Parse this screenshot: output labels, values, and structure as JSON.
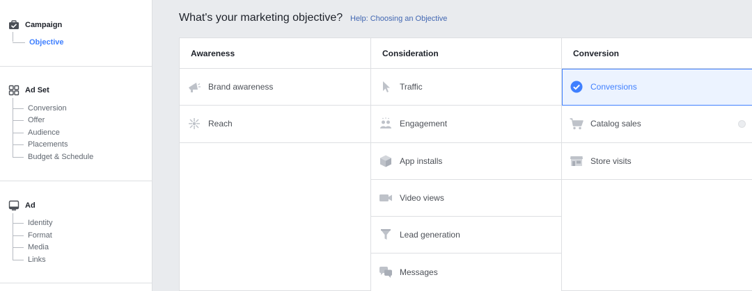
{
  "sidebar": {
    "campaign": {
      "label": "Campaign",
      "icon": "briefcase-icon",
      "items": [
        {
          "label": "Objective",
          "active": true
        }
      ]
    },
    "adset": {
      "label": "Ad Set",
      "icon": "grid-icon",
      "items": [
        {
          "label": "Conversion"
        },
        {
          "label": "Offer"
        },
        {
          "label": "Audience"
        },
        {
          "label": "Placements"
        },
        {
          "label": "Budget & Schedule"
        }
      ]
    },
    "ad": {
      "label": "Ad",
      "icon": "monitor-icon",
      "items": [
        {
          "label": "Identity"
        },
        {
          "label": "Format"
        },
        {
          "label": "Media"
        },
        {
          "label": "Links"
        }
      ]
    }
  },
  "main": {
    "title": "What's your marketing objective?",
    "help_link": "Help: Choosing an Objective",
    "columns": [
      {
        "label": "Awareness",
        "options": [
          {
            "label": "Brand awareness",
            "icon": "megaphone-icon"
          },
          {
            "label": "Reach",
            "icon": "reach-icon"
          }
        ]
      },
      {
        "label": "Consideration",
        "options": [
          {
            "label": "Traffic",
            "icon": "cursor-icon"
          },
          {
            "label": "Engagement",
            "icon": "people-icon"
          },
          {
            "label": "App installs",
            "icon": "box-icon"
          },
          {
            "label": "Video views",
            "icon": "video-camera-icon"
          },
          {
            "label": "Lead generation",
            "icon": "funnel-icon"
          },
          {
            "label": "Messages",
            "icon": "chat-bubbles-icon"
          }
        ]
      },
      {
        "label": "Conversion",
        "options": [
          {
            "label": "Conversions",
            "icon": "check-circle-icon",
            "selected": true
          },
          {
            "label": "Catalog sales",
            "icon": "cart-icon"
          },
          {
            "label": "Store visits",
            "icon": "store-icon"
          }
        ]
      }
    ]
  },
  "colors": {
    "accent": "#4080ff",
    "selected_bg": "#ecf3ff",
    "icon_gray": "#bec2c9",
    "border": "#dddfe2"
  }
}
